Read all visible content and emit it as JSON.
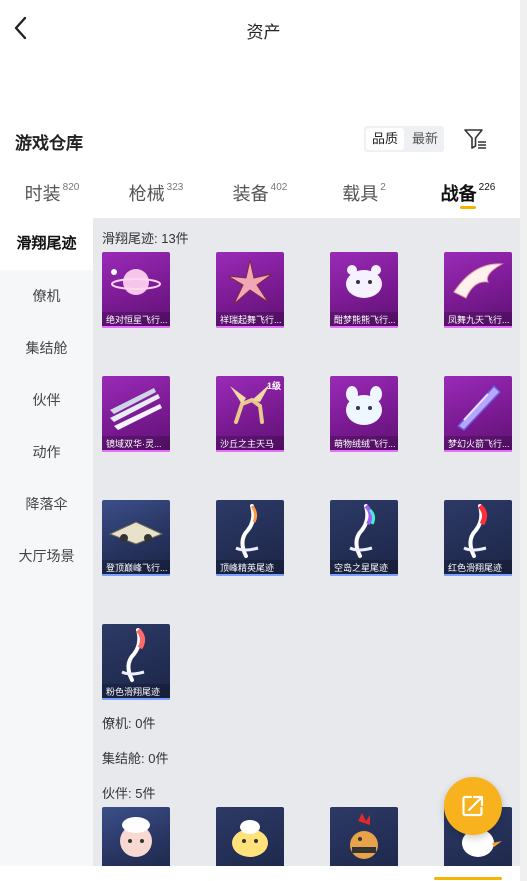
{
  "header": {
    "title": "资产",
    "back_icon": "chevron-left-icon"
  },
  "warehouse": {
    "title": "游戏仓库",
    "sort": [
      "品质",
      "最新"
    ],
    "filter_icon": "filter-icon"
  },
  "tabs": [
    {
      "label": "时装",
      "count": "820"
    },
    {
      "label": "枪械",
      "count": "323"
    },
    {
      "label": "装备",
      "count": "402"
    },
    {
      "label": "载具",
      "count": "2"
    },
    {
      "label": "战备",
      "count": "226"
    }
  ],
  "active_tab_index": 4,
  "sidebar": [
    "滑翔尾迹",
    "僚机",
    "集结舱",
    "伙伴",
    "动作",
    "降落伞",
    "大厅场景"
  ],
  "sections": [
    {
      "title": "滑翔尾迹: 13件"
    },
    {
      "title": "僚机: 0件"
    },
    {
      "title": "集结舱: 0件"
    },
    {
      "title": "伙伴: 5件"
    }
  ],
  "items": [
    {
      "name": "绝对恒星飞行...",
      "rarity": "purple",
      "icon": "planet-icon"
    },
    {
      "name": "祥瑞起舞飞行...",
      "rarity": "purple",
      "icon": "starfish-icon"
    },
    {
      "name": "酣梦熊熊飞行...",
      "rarity": "purple",
      "icon": "bear-icon"
    },
    {
      "name": "凤舞九天飞行...",
      "rarity": "purple",
      "icon": "phoenix-icon"
    },
    {
      "name": "镜域双华·灵...",
      "rarity": "purple",
      "icon": "blades-icon"
    },
    {
      "name": "沙丘之主天马",
      "rarity": "purple",
      "icon": "pegasus-icon",
      "level": "1级"
    },
    {
      "name": "萌物绒绒飞行...",
      "rarity": "purple",
      "icon": "plush-icon"
    },
    {
      "name": "梦幻火箭飞行...",
      "rarity": "purple",
      "icon": "rocket-icon"
    },
    {
      "name": "登顶巅峰飞行...",
      "rarity": "blue",
      "icon": "jet-icon"
    },
    {
      "name": "顶峰精英尾迹",
      "rarity": "dark",
      "icon": "trail-icon"
    },
    {
      "name": "空岛之星尾迹",
      "rarity": "dark",
      "icon": "rainbow-trail-icon"
    },
    {
      "name": "红色滑翔尾迹",
      "rarity": "dark",
      "icon": "red-trail-icon"
    },
    {
      "name": "粉色滑翔尾迹",
      "rarity": "dark",
      "icon": "pink-trail-icon"
    }
  ],
  "companions": [
    {
      "icon": "sheep-icon"
    },
    {
      "icon": "chick-icon"
    },
    {
      "icon": "rooster-icon"
    },
    {
      "icon": "bird-icon"
    }
  ],
  "fab_icon": "share-icon",
  "colors": {
    "accent": "#f5b400",
    "purple": "#8a22a6",
    "blue": "#27345f",
    "fab": "#f7b21e"
  }
}
